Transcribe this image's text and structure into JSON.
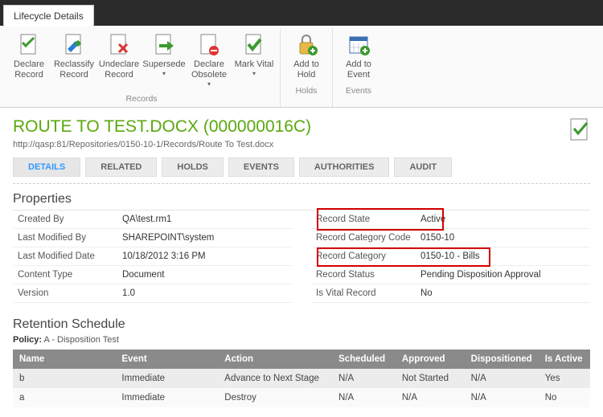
{
  "tab": {
    "label": "Lifecycle Details"
  },
  "ribbon": {
    "groups": [
      {
        "label": "Records",
        "items": [
          {
            "name": "declare-record",
            "label": "Declare Record"
          },
          {
            "name": "reclassify-record",
            "label": "Reclassify Record"
          },
          {
            "name": "undeclare-record",
            "label": "Undeclare Record"
          },
          {
            "name": "supersede",
            "label": "Supersede"
          },
          {
            "name": "declare-obsolete",
            "label": "Declare Obsolete"
          },
          {
            "name": "mark-vital",
            "label": "Mark Vital"
          }
        ]
      },
      {
        "label": "Holds",
        "items": [
          {
            "name": "add-to-hold",
            "label": "Add to Hold"
          }
        ]
      },
      {
        "label": "Events",
        "items": [
          {
            "name": "add-to-event",
            "label": "Add to Event"
          }
        ]
      }
    ]
  },
  "page": {
    "title": "ROUTE TO TEST.DOCX (000000016C)",
    "path": "http://qasp:81/Repositories/0150-10-1/Records/Route To Test.docx"
  },
  "subtabs": [
    {
      "label": "DETAILS",
      "active": true
    },
    {
      "label": "RELATED"
    },
    {
      "label": "HOLDS"
    },
    {
      "label": "EVENTS"
    },
    {
      "label": "AUTHORITIES"
    },
    {
      "label": "AUDIT"
    }
  ],
  "properties": {
    "title": "Properties",
    "left": [
      {
        "label": "Created By",
        "value": "QA\\test.rm1"
      },
      {
        "label": "Last Modified By",
        "value": "SHAREPOINT\\system"
      },
      {
        "label": "Last Modified Date",
        "value": "10/18/2012 3:16 PM"
      },
      {
        "label": "Content Type",
        "value": "Document"
      },
      {
        "label": "Version",
        "value": "1.0"
      }
    ],
    "right": [
      {
        "label": "Record State",
        "value": "Active"
      },
      {
        "label": "Record Category Code",
        "value": "0150-10"
      },
      {
        "label": "Record Category",
        "value": "0150-10 - Bills"
      },
      {
        "label": "Record Status",
        "value": "Pending Disposition Approval"
      },
      {
        "label": "Is Vital Record",
        "value": "No"
      }
    ]
  },
  "retention": {
    "title": "Retention Schedule",
    "policy_label": "Policy:",
    "policy_value": "A - Disposition Test",
    "headers": [
      "Name",
      "Event",
      "Action",
      "Scheduled",
      "Approved",
      "Dispositioned",
      "Is Active"
    ],
    "rows": [
      [
        "b",
        "Immediate",
        "Advance to Next Stage",
        "N/A",
        "Not Started",
        "N/A",
        "Yes"
      ],
      [
        "a",
        "Immediate",
        "Destroy",
        "N/A",
        "N/A",
        "N/A",
        "No"
      ]
    ]
  }
}
